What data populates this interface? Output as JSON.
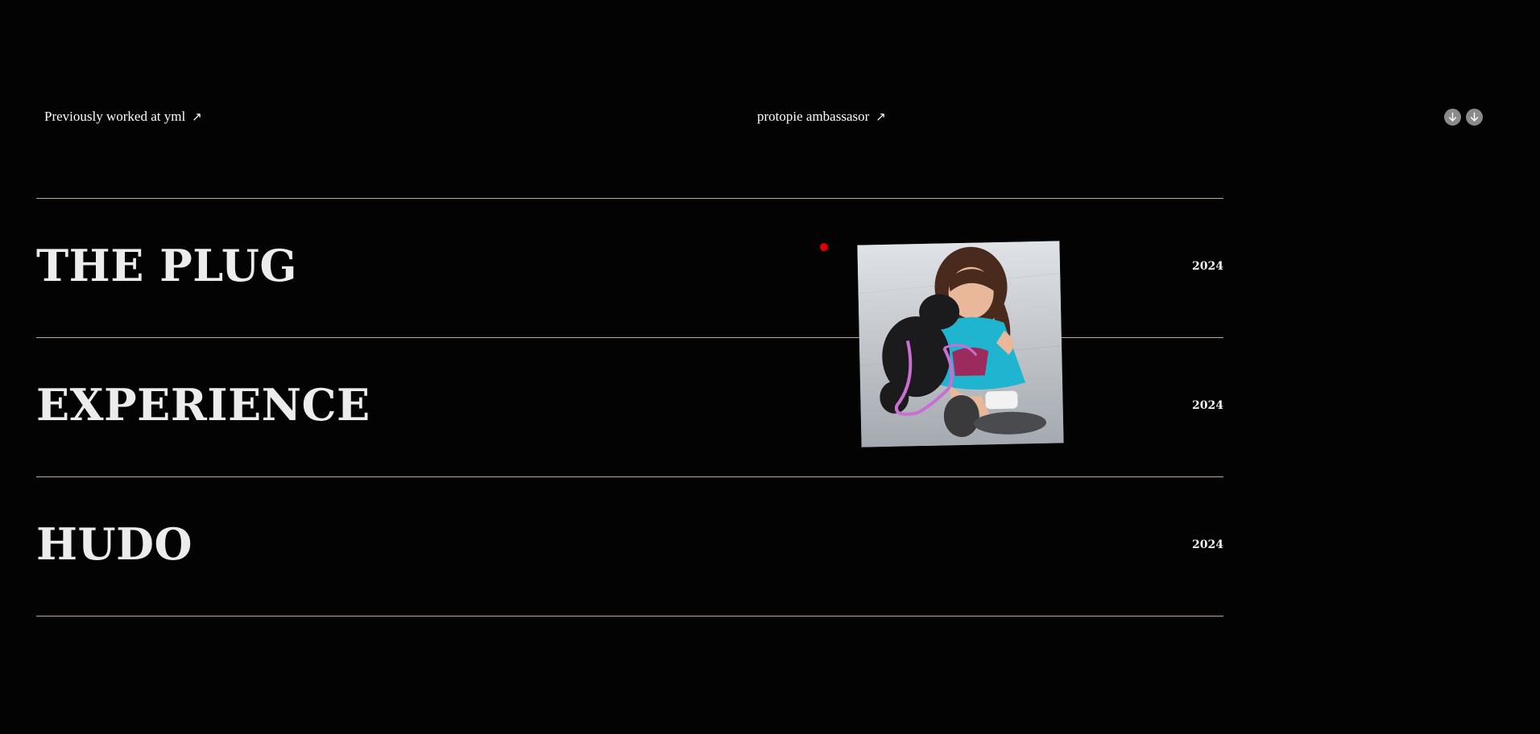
{
  "header": {
    "left_link": "Previously worked at yml",
    "center_link": "protopie ambassasor",
    "link_arrow": "↗",
    "buttons": [
      "arrow-down-icon",
      "arrow-down-icon"
    ]
  },
  "projects": [
    {
      "title": "THE PLUG",
      "year": "2024"
    },
    {
      "title": "EXPERIENCE",
      "year": "2024"
    },
    {
      "title": "HUDO",
      "year": "2024"
    }
  ],
  "colors": {
    "background": "#030303",
    "divider": "#b8aa96",
    "cursor_dot": "#e00000"
  },
  "preview": {
    "icon": "photo-girl-with-puppy"
  }
}
